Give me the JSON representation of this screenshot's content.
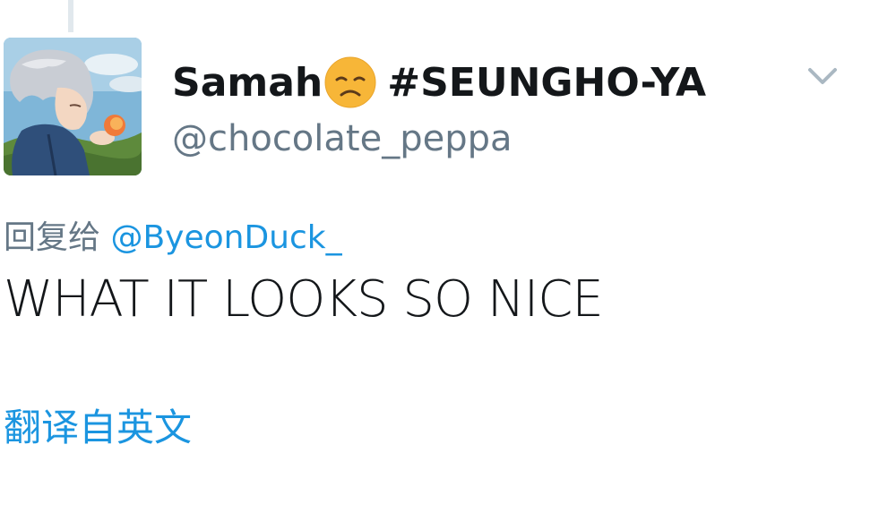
{
  "tweet": {
    "author": {
      "display_name": "Samah",
      "emoji": "disappointed-face-emoji",
      "display_name_suffix": "#SEUNGHO-YA",
      "username": "@chocolate_peppa",
      "avatar": "anime-character-avatar"
    },
    "menu_icon": "chevron-down-icon",
    "reply_prefix": "回复给",
    "reply_to": "@ByeonDuck_",
    "text": "WHAT IT LOOKS SO NICE",
    "translate_link": "翻译自英文"
  },
  "colors": {
    "text_primary": "#14171a",
    "text_secondary": "#657786",
    "link": "#1b95e0",
    "thread_line": "#e1e8ed",
    "emoji": "#f7b638"
  }
}
